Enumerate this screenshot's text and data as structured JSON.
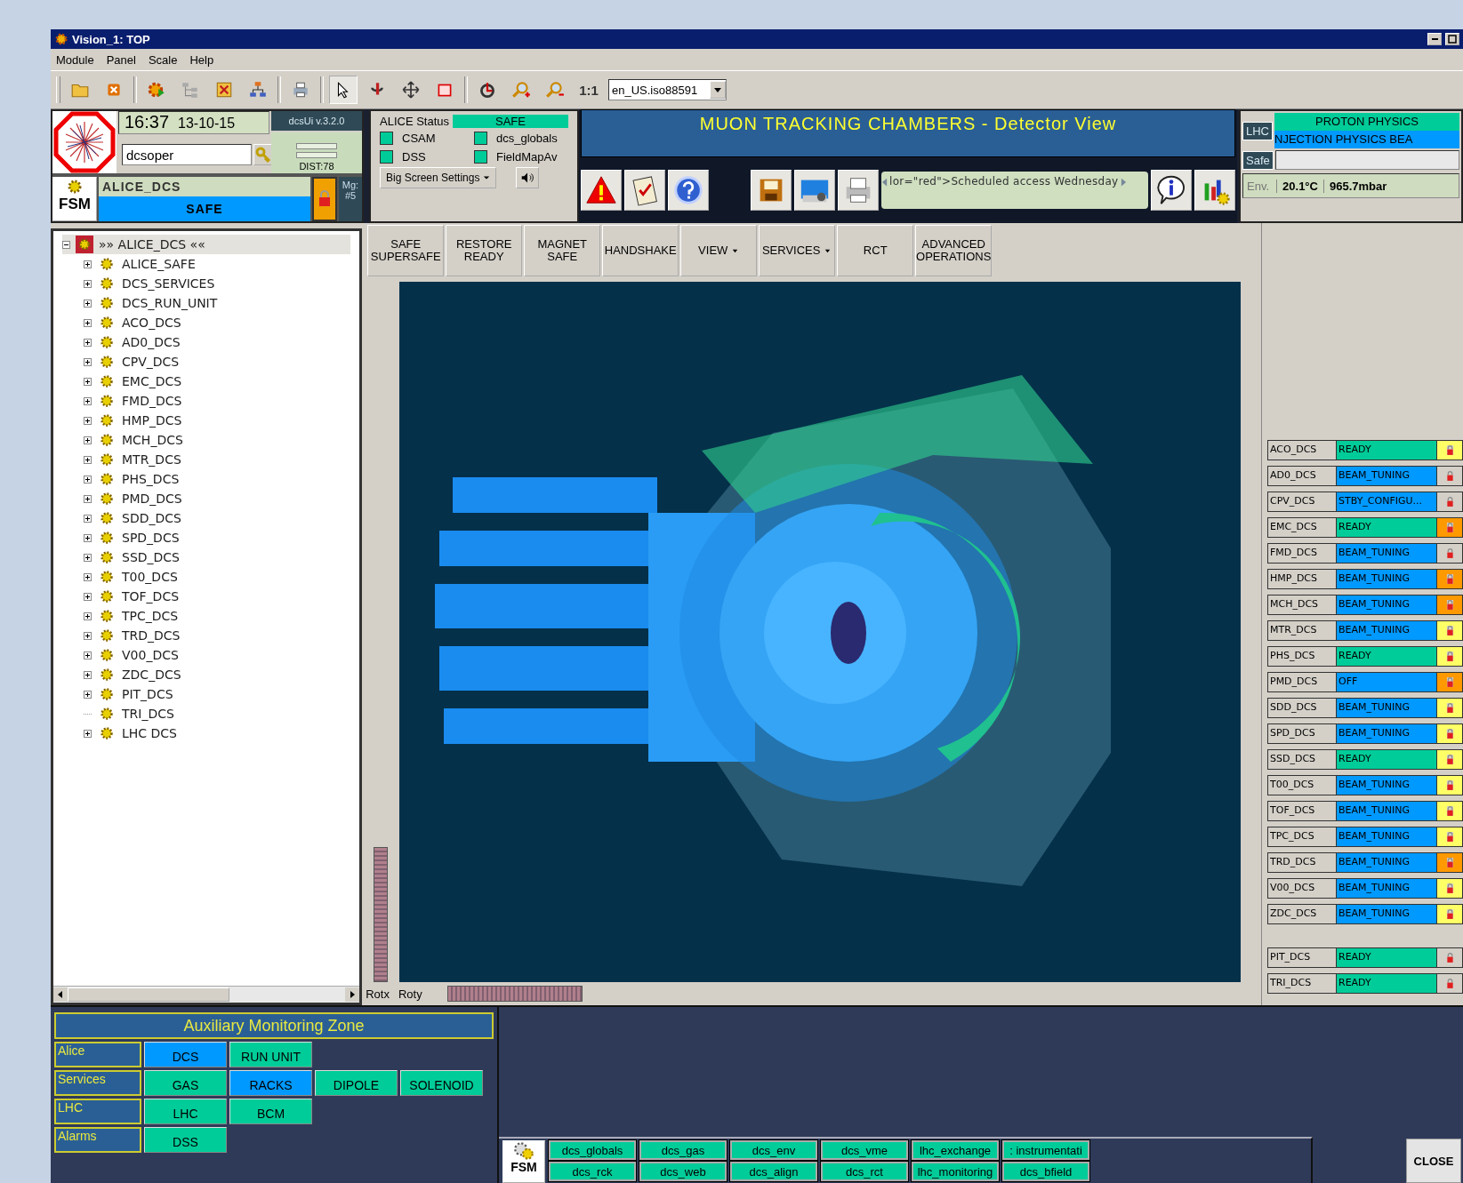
{
  "window": {
    "title": "Vision_1: TOP"
  },
  "menu": [
    "Module",
    "Panel",
    "Scale",
    "Help"
  ],
  "toolbar": {
    "zoom_label": "1:1",
    "locale": "en_US.iso88591"
  },
  "header": {
    "time": "16:37",
    "date": "13-10-15",
    "version": "dcsUi v.3.2.0",
    "user": "dcsoper",
    "dist": "DIST:78",
    "fsm_label": "FSM",
    "node": "ALICE_DCS",
    "node_state": "SAFE",
    "mg_label": "Mg:",
    "mg_value": "#5"
  },
  "alice_status": {
    "label": "ALICE Status",
    "state": "SAFE",
    "indicators": [
      "CSAM",
      "dcs_globals",
      "DSS",
      "FieldMapAv"
    ],
    "settings": "Big Screen Settings"
  },
  "banner": "MUON TRACKING CHAMBERS - Detector View",
  "message": "lor=\"red\">Scheduled access Wednesday",
  "lhc": {
    "label": "LHC",
    "mode": "PROTON PHYSICS",
    "beam": "NJECTION PHYSICS BEA",
    "safe_label": "Safe",
    "env_label": "Env.",
    "temperature": "20.1°C",
    "pressure": "965.7mbar"
  },
  "actions": [
    {
      "label": "SAFE\nSUPERSAFE",
      "dropdown": false
    },
    {
      "label": "RESTORE\nREADY",
      "dropdown": false
    },
    {
      "label": "MAGNET\nSAFE",
      "dropdown": false
    },
    {
      "label": "HANDSHAKE",
      "dropdown": false
    },
    {
      "label": "VIEW",
      "dropdown": true
    },
    {
      "label": "SERVICES",
      "dropdown": true
    },
    {
      "label": "RCT",
      "dropdown": false
    },
    {
      "label": "ADVANCED\nOPERATIONS",
      "dropdown": false
    }
  ],
  "tree": {
    "label": "»» ALICE_DCS ««",
    "expanded": true,
    "children": [
      {
        "label": "ALICE_SAFE",
        "expandable": true
      },
      {
        "label": "DCS_SERVICES",
        "expandable": true
      },
      {
        "label": "DCS_RUN_UNIT",
        "expandable": true
      },
      {
        "label": "ACO_DCS",
        "expandable": true
      },
      {
        "label": "AD0_DCS",
        "expandable": true
      },
      {
        "label": "CPV_DCS",
        "expandable": true
      },
      {
        "label": "EMC_DCS",
        "expandable": true
      },
      {
        "label": "FMD_DCS",
        "expandable": true
      },
      {
        "label": "HMP_DCS",
        "expandable": true
      },
      {
        "label": "MCH_DCS",
        "expandable": true
      },
      {
        "label": "MTR_DCS",
        "expandable": true
      },
      {
        "label": "PHS_DCS",
        "expandable": true
      },
      {
        "label": "PMD_DCS",
        "expandable": true
      },
      {
        "label": "SDD_DCS",
        "expandable": true
      },
      {
        "label": "SPD_DCS",
        "expandable": true
      },
      {
        "label": "SSD_DCS",
        "expandable": true
      },
      {
        "label": "T00_DCS",
        "expandable": true
      },
      {
        "label": "TOF_DCS",
        "expandable": true
      },
      {
        "label": "TPC_DCS",
        "expandable": true
      },
      {
        "label": "TRD_DCS",
        "expandable": true
      },
      {
        "label": "V00_DCS",
        "expandable": true
      },
      {
        "label": "ZDC_DCS",
        "expandable": true
      },
      {
        "label": "PIT_DCS",
        "expandable": true
      },
      {
        "label": "TRI_DCS",
        "expandable": false
      },
      {
        "label": "LHC DCS",
        "expandable": true
      }
    ]
  },
  "view": {
    "kind": "picture",
    "rot_labels": [
      "Rotx",
      "Roty"
    ],
    "vertical_slider": {
      "level": 1
    },
    "rotation_slider": {
      "level": 1
    }
  },
  "subsystems": [
    {
      "name": "ACO_DCS",
      "state": "READY",
      "color": "#00cc99",
      "lock": {
        "color": "#ffff66"
      }
    },
    {
      "name": "AD0_DCS",
      "state": "BEAM_TUNING",
      "color": "#0099ff",
      "lock": {
        "color": "#d4d0c8"
      }
    },
    {
      "name": "CPV_DCS",
      "state": "STBY_CONFIGU...",
      "color": "#0099ff",
      "lock": {
        "color": "#d4d0c8"
      }
    },
    {
      "name": "EMC_DCS",
      "state": "READY",
      "color": "#00cc99",
      "lock": {
        "color": "#ff9900"
      }
    },
    {
      "name": "FMD_DCS",
      "state": "BEAM_TUNING",
      "color": "#0099ff",
      "lock": {
        "color": "#d4d0c8"
      }
    },
    {
      "name": "HMP_DCS",
      "state": "BEAM_TUNING",
      "color": "#0099ff",
      "lock": {
        "color": "#ff9900"
      }
    },
    {
      "name": "MCH_DCS",
      "state": "BEAM_TUNING",
      "color": "#0099ff",
      "lock": {
        "color": "#ff9900"
      }
    },
    {
      "name": "MTR_DCS",
      "state": "BEAM_TUNING",
      "color": "#0099ff",
      "lock": {
        "color": "#ffff66"
      }
    },
    {
      "name": "PHS_DCS",
      "state": "READY",
      "color": "#00cc99",
      "lock": {
        "color": "#ffff66"
      }
    },
    {
      "name": "PMD_DCS",
      "state": "OFF",
      "color": "#0099ff",
      "lock": {
        "color": "#ff9900"
      }
    },
    {
      "name": "SDD_DCS",
      "state": "BEAM_TUNING",
      "color": "#0099ff",
      "lock": {
        "color": "#ffff66"
      }
    },
    {
      "name": "SPD_DCS",
      "state": "BEAM_TUNING",
      "color": "#0099ff",
      "lock": {
        "color": "#ffff66"
      }
    },
    {
      "name": "SSD_DCS",
      "state": "READY",
      "color": "#00cc99",
      "lock": {
        "color": "#ffff66"
      }
    },
    {
      "name": "T00_DCS",
      "state": "BEAM_TUNING",
      "color": "#0099ff",
      "lock": {
        "color": "#ffff66"
      }
    },
    {
      "name": "TOF_DCS",
      "state": "BEAM_TUNING",
      "color": "#0099ff",
      "lock": {
        "color": "#ffff66"
      }
    },
    {
      "name": "TPC_DCS",
      "state": "BEAM_TUNING",
      "color": "#0099ff",
      "lock": {
        "color": "#ffff66"
      }
    },
    {
      "name": "TRD_DCS",
      "state": "BEAM_TUNING",
      "color": "#0099ff",
      "lock": {
        "color": "#ff9900"
      }
    },
    {
      "name": "V00_DCS",
      "state": "BEAM_TUNING",
      "color": "#0099ff",
      "lock": {
        "color": "#ffff66"
      }
    },
    {
      "name": "ZDC_DCS",
      "state": "BEAM_TUNING",
      "color": "#0099ff",
      "lock": {
        "color": "#ffff66"
      }
    }
  ],
  "extra_subsystems": [
    {
      "name": "PIT_DCS",
      "state": "READY",
      "color": "#00cc99",
      "lock": {
        "color": "#d4d0c8"
      }
    },
    {
      "name": "TRI_DCS",
      "state": "READY",
      "color": "#00cc99",
      "lock": {
        "color": "#d4d0c8"
      }
    }
  ],
  "aux_zone": {
    "title": "Auxiliary Monitoring Zone",
    "rows": [
      {
        "label": "Alice",
        "buttons": [
          {
            "label": "DCS",
            "color": "#0099ff"
          },
          {
            "label": "RUN UNIT",
            "color": "#00cc99"
          }
        ]
      },
      {
        "label": "Services",
        "buttons": [
          {
            "label": "GAS",
            "color": "#00cc99"
          },
          {
            "label": "RACKS",
            "color": "#0099ff"
          },
          {
            "label": "DIPOLE",
            "color": "#00cc99"
          },
          {
            "label": "SOLENOID",
            "color": "#00cc99"
          }
        ]
      },
      {
        "label": "LHC",
        "buttons": [
          {
            "label": "LHC",
            "color": "#00cc99"
          },
          {
            "label": "BCM",
            "color": "#00cc99"
          }
        ]
      },
      {
        "label": "Alarms",
        "buttons": [
          {
            "label": "DSS",
            "color": "#00cc99"
          }
        ]
      }
    ]
  },
  "fsm_panel": {
    "label": "FSM",
    "buttons": [
      [
        "dcs_globals",
        "dcs_gas",
        "dcs_env",
        "dcs_vme",
        "lhc_exchange",
        ": instrumentati"
      ],
      [
        "dcs_rck",
        "dcs_web",
        "dcs_align",
        "dcs_rct",
        "lhc_monitoring",
        "dcs_bfield"
      ]
    ]
  },
  "close_button": "CLOSE"
}
